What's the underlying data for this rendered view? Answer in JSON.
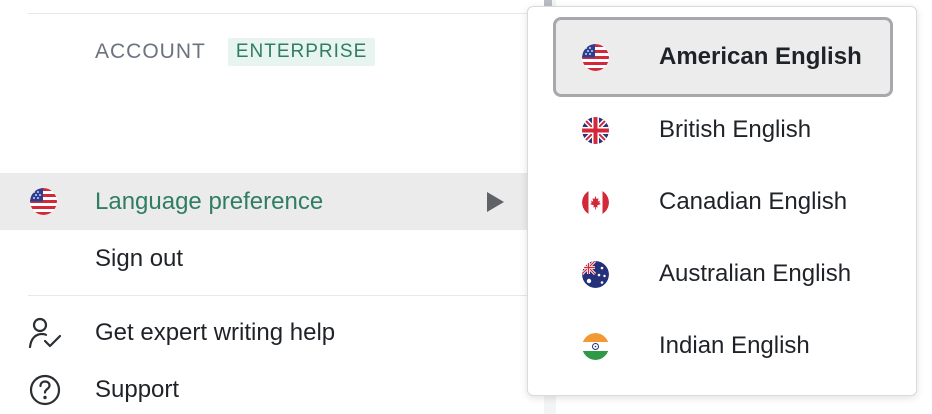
{
  "account_menu": {
    "account_label": "ACCOUNT",
    "plan_badge": "ENTERPRISE",
    "items": [
      {
        "label": "Language preference",
        "icon": "us-flag-icon",
        "highlighted": true,
        "has_submenu": true
      },
      {
        "label": "Sign out"
      },
      {
        "label": "Get expert writing help",
        "icon": "person-check-icon"
      },
      {
        "label": "Support",
        "icon": "question-circle-icon"
      }
    ]
  },
  "language_dropdown": {
    "options": [
      {
        "label": "American English",
        "icon": "us-flag-icon",
        "selected": true
      },
      {
        "label": "British English",
        "icon": "uk-flag-icon",
        "selected": false
      },
      {
        "label": "Canadian English",
        "icon": "canada-flag-icon",
        "selected": false
      },
      {
        "label": "Australian English",
        "icon": "australia-flag-icon",
        "selected": false
      },
      {
        "label": "Indian English",
        "icon": "india-flag-icon",
        "selected": false
      }
    ]
  },
  "colors": {
    "accent_green": "#2f7d64",
    "badge_bg": "#e8f4ef",
    "highlight_bg": "#ebebeb",
    "selected_border": "#a6a8ab"
  }
}
